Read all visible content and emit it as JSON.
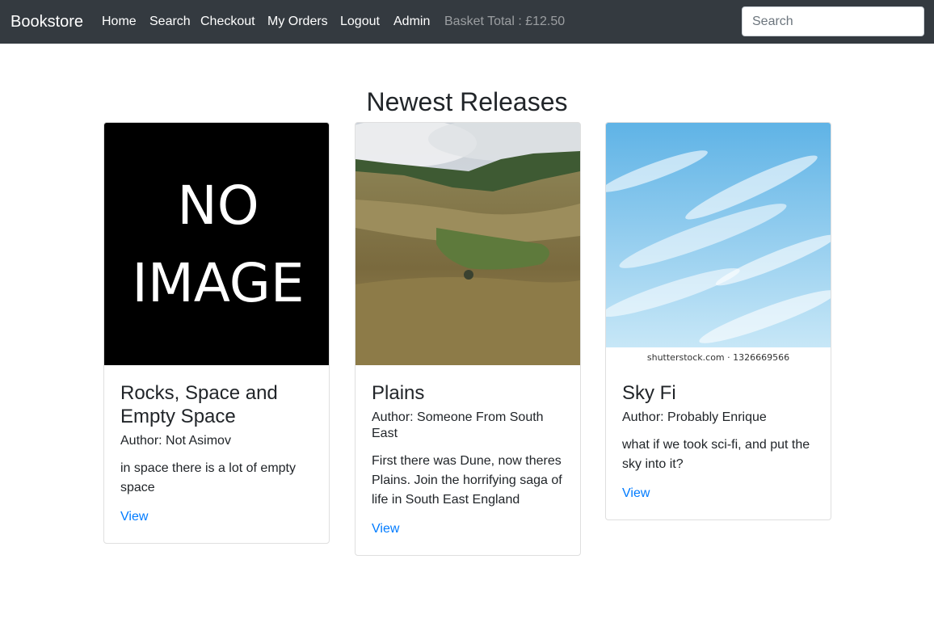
{
  "navbar": {
    "brand": "Bookstore",
    "links": [
      "Home",
      "Search",
      "Checkout",
      "My Orders",
      "Logout",
      "Admin"
    ],
    "basket_total": "Basket Total : £12.50",
    "search_placeholder": "Search"
  },
  "main": {
    "heading": "Newest Releases",
    "books": [
      {
        "image_text_line1": "NO",
        "image_text_line2": "IMAGE",
        "title": "Rocks, Space and Empty Space",
        "author": "Author: Not Asimov",
        "description": "in space there is a lot of empty space",
        "link": "View"
      },
      {
        "title": "Plains",
        "author": "Author: Someone From South East",
        "description": "First there was Dune, now theres Plains. Join the horrifying saga of life in South East England",
        "link": "View"
      },
      {
        "image_caption": "shutterstock.com · 1326669566",
        "title": "Sky Fi",
        "author": "Author: Probably Enrique",
        "description": "what if we took sci-fi, and put the sky into it?",
        "link": "View"
      }
    ]
  }
}
